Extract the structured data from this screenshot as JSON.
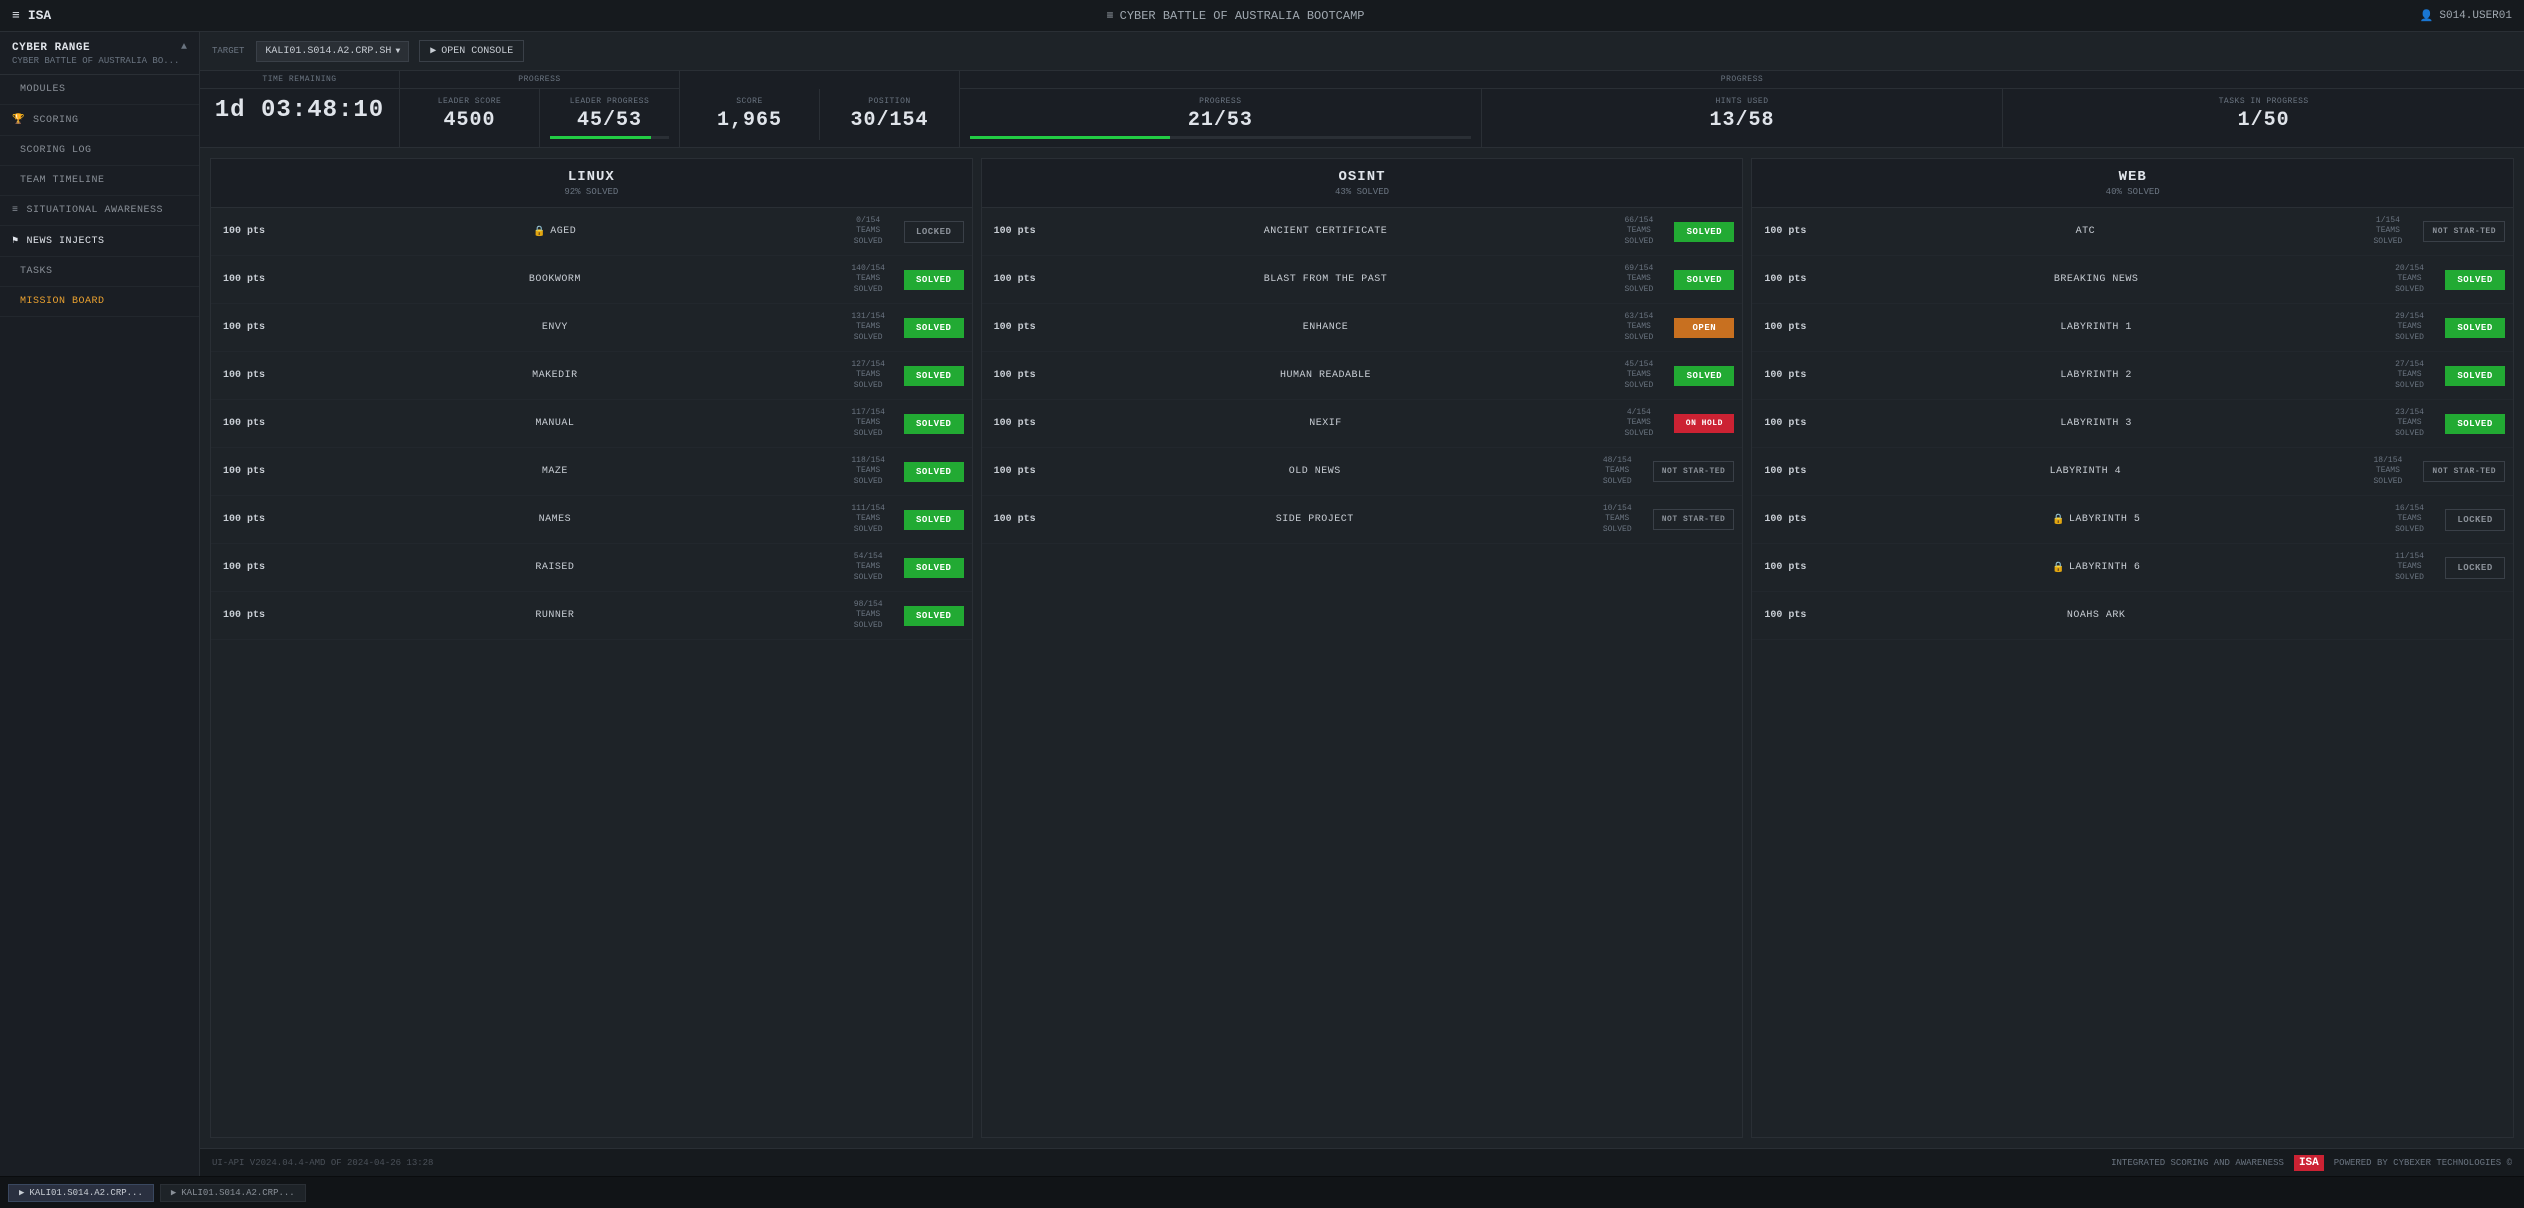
{
  "topbar": {
    "menu_icon": "≡",
    "app_name": "ISA",
    "title_icon": "≡",
    "title": "CYBER BATTLE OF AUSTRALIA BOOTCAMP",
    "user_icon": "👤",
    "user": "S014.USER01"
  },
  "sidebar": {
    "range_title": "CYBER RANGE",
    "range_subtitle": "CYBER BATTLE OF AUSTRALIA BO...",
    "items": [
      {
        "id": "modules",
        "label": "MODULES",
        "icon": ""
      },
      {
        "id": "scoring",
        "label": "SCORING",
        "icon": "🏆"
      },
      {
        "id": "scoring-log",
        "label": "SCORING LOG",
        "icon": ""
      },
      {
        "id": "team-timeline",
        "label": "TEAM TIMELINE",
        "icon": ""
      },
      {
        "id": "situational-awareness",
        "label": "SITUATIONAL AWARENESS",
        "icon": "≡"
      },
      {
        "id": "news-injects",
        "label": "NEWS INJECTS",
        "icon": "⚑"
      },
      {
        "id": "tasks",
        "label": "TASKS",
        "icon": ""
      },
      {
        "id": "mission-board",
        "label": "MISSION BOARD",
        "icon": ""
      }
    ]
  },
  "subheader": {
    "target_label": "TARGET",
    "target_value": "KALI01.S014.A2.CRP.SH",
    "console_label": "OPEN CONSOLE"
  },
  "stats": {
    "time_remaining_label": "TIME REMAINING",
    "time_remaining": "1d 03:48:10",
    "progress_label": "PROGRESS",
    "leader_score_label": "LEADER SCORE",
    "leader_score": "4500",
    "leader_progress_label": "LEADER PROGRESS",
    "leader_progress": "45/53",
    "leader_progress_pct": 85,
    "score_label": "SCORE",
    "score": "1,965",
    "position_label": "POSITION",
    "position": "30/154",
    "progress2_label": "PROGRESS",
    "progress2": "21/53",
    "progress2_pct": 40,
    "hints_label": "HINTS USED",
    "hints": "13/58",
    "tasks_label": "TASKS IN PROGRESS",
    "tasks": "1/50"
  },
  "columns": [
    {
      "id": "linux",
      "title": "LINUX",
      "subtitle": "92% SOLVED",
      "challenges": [
        {
          "pts": "100 pts",
          "name": "AGED",
          "teams": "0/154\nTEAMS\nSOLVED",
          "status": "LOCKED",
          "status_type": "locked",
          "locked": true
        },
        {
          "pts": "100 pts",
          "name": "BOOKWORM",
          "teams": "140/154\nTEAMS\nSOLVED",
          "status": "SOLVED",
          "status_type": "solved"
        },
        {
          "pts": "100 pts",
          "name": "ENVY",
          "teams": "131/154\nTEAMS\nSOLVED",
          "status": "SOLVED",
          "status_type": "solved"
        },
        {
          "pts": "100 pts",
          "name": "MAKEDIR",
          "teams": "127/154\nTEAMS\nSOLVED",
          "status": "SOLVED",
          "status_type": "solved"
        },
        {
          "pts": "100 pts",
          "name": "MANUAL",
          "teams": "117/154\nTEAMS\nSOLVED",
          "status": "SOLVED",
          "status_type": "solved"
        },
        {
          "pts": "100 pts",
          "name": "MAZE",
          "teams": "118/154\nTEAMS\nSOLVED",
          "status": "SOLVED",
          "status_type": "solved"
        },
        {
          "pts": "100 pts",
          "name": "NAMES",
          "teams": "111/154\nTEAMS\nSOLVED",
          "status": "SOLVED",
          "status_type": "solved"
        },
        {
          "pts": "100 pts",
          "name": "RAISED",
          "teams": "54/154\nTEAMS\nSOLVED",
          "status": "SOLVED",
          "status_type": "solved"
        },
        {
          "pts": "100 pts",
          "name": "RUNNER",
          "teams": "98/154\nTEAMS\nSOLVED",
          "status": "SOLVED",
          "status_type": "solved"
        }
      ]
    },
    {
      "id": "osint",
      "title": "OSINT",
      "subtitle": "43% SOLVED",
      "challenges": [
        {
          "pts": "100 pts",
          "name": "ANCIENT CERTIFICATE",
          "teams": "66/154\nTEAMS\nSOLVED",
          "status": "SOLVED",
          "status_type": "solved"
        },
        {
          "pts": "100 pts",
          "name": "BLAST FROM THE PAST",
          "teams": "69/154\nTEAMS\nSOLVED",
          "status": "SOLVED",
          "status_type": "solved"
        },
        {
          "pts": "100 pts",
          "name": "ENHANCE",
          "teams": "63/154\nTEAMS\nSOLVED",
          "status": "OPEN",
          "status_type": "open"
        },
        {
          "pts": "100 pts",
          "name": "HUMAN READABLE",
          "teams": "45/154\nTEAMS\nSOLVED",
          "status": "SOLVED",
          "status_type": "solved"
        },
        {
          "pts": "100 pts",
          "name": "NEXIF",
          "teams": "4/154\nTEAMS\nSOLVED",
          "status": "ON HOLD",
          "status_type": "on-hold"
        },
        {
          "pts": "100 pts",
          "name": "OLD NEWS",
          "teams": "48/154\nTEAMS\nSOLVED",
          "status": "NOT STAR-TED",
          "status_type": "not-started"
        },
        {
          "pts": "100 pts",
          "name": "SIDE PROJECT",
          "teams": "10/154\nTEAMS\nSOLVED",
          "status": "NOT STAR-TED",
          "status_type": "not-started"
        }
      ]
    },
    {
      "id": "web",
      "title": "WEB",
      "subtitle": "40% SOLVED",
      "challenges": [
        {
          "pts": "100 pts",
          "name": "ATC",
          "teams": "1/154\nTEAMS\nSOLVED",
          "status": "NOT STAR-TED",
          "status_type": "not-started"
        },
        {
          "pts": "100 pts",
          "name": "BREAKING NEWS",
          "teams": "20/154\nTEAMS\nSOLVED",
          "status": "SOLVED",
          "status_type": "solved"
        },
        {
          "pts": "100 pts",
          "name": "LABYRINTH 1",
          "teams": "29/154\nTEAMS\nSOLVED",
          "status": "SOLVED",
          "status_type": "solved"
        },
        {
          "pts": "100 pts",
          "name": "LABYRINTH 2",
          "teams": "27/154\nTEAMS\nSOLVED",
          "status": "SOLVED",
          "status_type": "solved"
        },
        {
          "pts": "100 pts",
          "name": "LABYRINTH 3",
          "teams": "23/154\nTEAMS\nSOLVED",
          "status": "SOLVED",
          "status_type": "solved"
        },
        {
          "pts": "100 pts",
          "name": "LABYRINTH 4",
          "teams": "18/154\nTEAMS\nSOLVED",
          "status": "NOT STAR-TED",
          "status_type": "not-started"
        },
        {
          "pts": "100 pts",
          "name": "LABYRINTH 5",
          "teams": "16/154\nTEAMS\nSOLVED",
          "status": "LOCKED",
          "status_type": "locked",
          "locked": true
        },
        {
          "pts": "100 pts",
          "name": "LABYRINTH 6",
          "teams": "11/154\nTEAMS\nSOLVED",
          "status": "LOCKED",
          "status_type": "locked",
          "locked": true
        },
        {
          "pts": "100 pts",
          "name": "NOAHS ARK",
          "teams": "",
          "status": "",
          "status_type": ""
        }
      ]
    }
  ],
  "footer": {
    "version": "UI-API V2024.04.4-AMD OF 2024-04-26 13:28",
    "powered_by": "POWERED BY CYBEXER TECHNOLOGIES ©",
    "isa_text": "INTEGRATED SCORING AND AWARENESS",
    "isa_logo": "ISA"
  },
  "taskbar": {
    "items": [
      {
        "id": "kali-active",
        "label": "KALI01.S014.A2.CRP...",
        "active": true
      },
      {
        "id": "kali-2",
        "label": "KALI01.S014.A2.CRP..."
      }
    ]
  }
}
